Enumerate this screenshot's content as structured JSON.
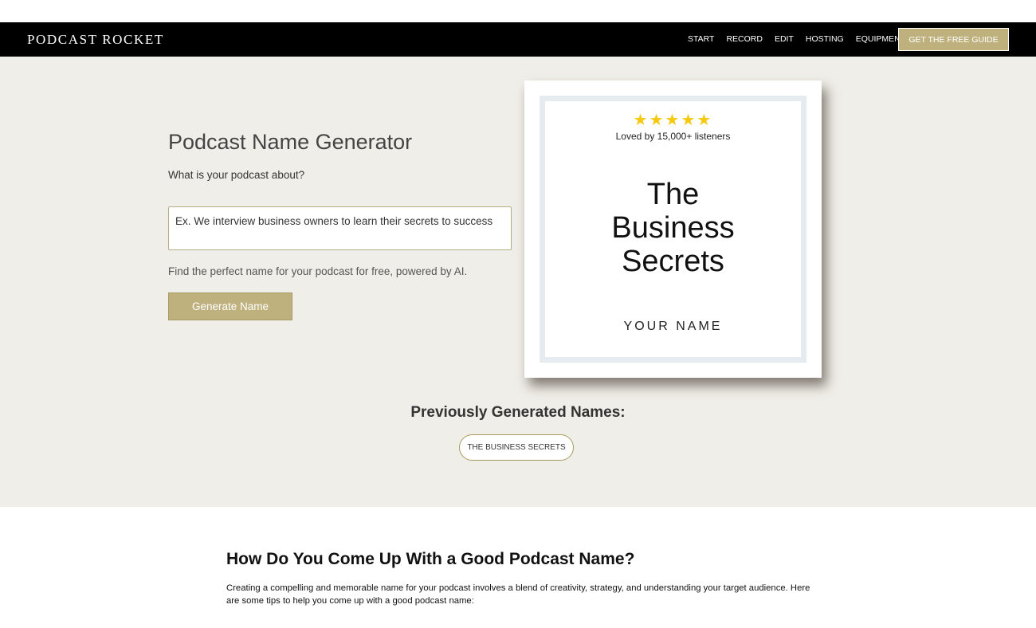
{
  "nav": {
    "logo": "PODCAST ROCKET",
    "links": [
      "START",
      "RECORD",
      "EDIT",
      "HOSTING",
      "EQUIPMENT"
    ],
    "cta": "GET THE FREE GUIDE"
  },
  "generator": {
    "title": "Podcast Name Generator",
    "question": "What is your podcast about?",
    "input_placeholder": "Ex. We interview business owners to learn their secrets to success",
    "input_value": "",
    "subtitle": "Find the perfect name for your podcast for free, powered by AI.",
    "button_label": "Generate Name"
  },
  "cover": {
    "stars": "★★★★★",
    "rating": 5,
    "loved_text": "Loved by 15,000+ listeners",
    "title_lines": [
      "The",
      "Business",
      "Secrets"
    ],
    "author": "YOUR NAME"
  },
  "previous": {
    "heading": "Previously Generated Names:",
    "names": [
      "THE BUSINESS SECRETS"
    ]
  },
  "article": {
    "title": "How Do You Come Up With a Good Podcast Name?",
    "body": "Creating a compelling and memorable name for your podcast involves a blend of creativity, strategy, and understanding your target audience. Here are some tips to help you come up with a good podcast name:"
  },
  "colors": {
    "accent": "#bfb17e",
    "hero_bg": "#f0eee8",
    "nav_bg": "#000000",
    "star": "#f6c90e"
  }
}
